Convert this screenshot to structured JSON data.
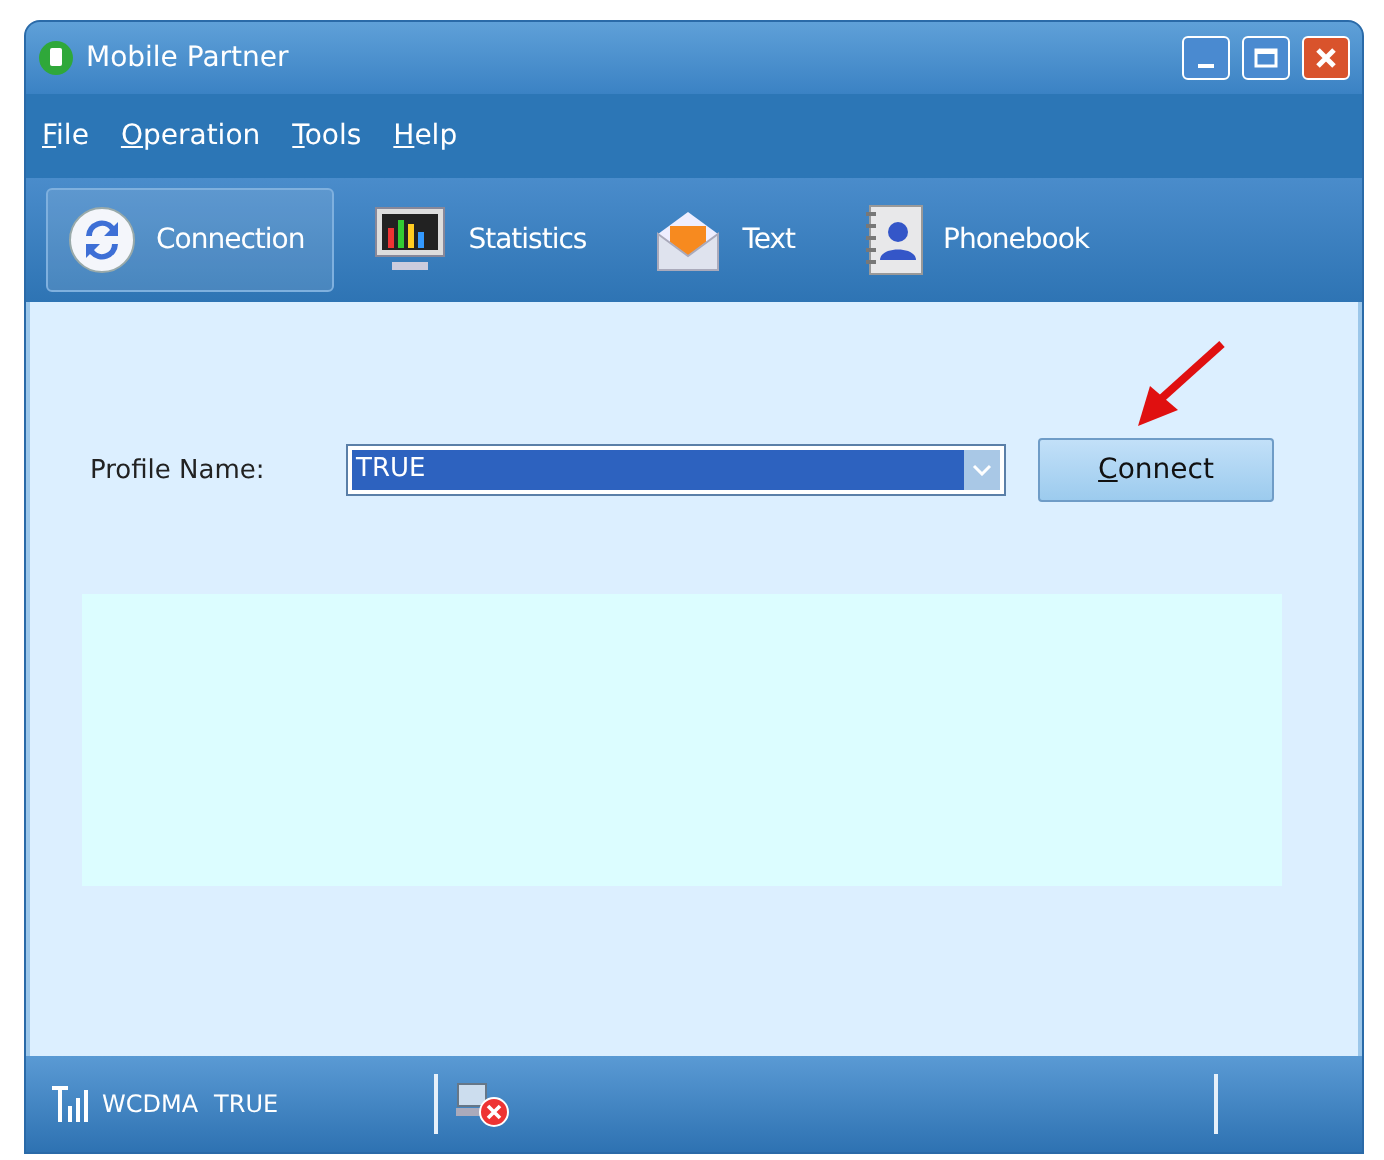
{
  "window": {
    "title": "Mobile Partner"
  },
  "menu": [
    "File",
    "Operation",
    "Tools",
    "Help"
  ],
  "toolbar": [
    {
      "label": "Connection",
      "kind": "connection",
      "selected": true
    },
    {
      "label": "Statistics",
      "kind": "statistics",
      "selected": false
    },
    {
      "label": "Text",
      "kind": "text",
      "selected": false
    },
    {
      "label": "Phonebook",
      "kind": "phonebook",
      "selected": false
    }
  ],
  "profile": {
    "label": "Profile Name:",
    "value": "TRUE"
  },
  "connect_button": "Connect",
  "status_bar": {
    "network": "WCDMA",
    "operator": "TRUE"
  }
}
